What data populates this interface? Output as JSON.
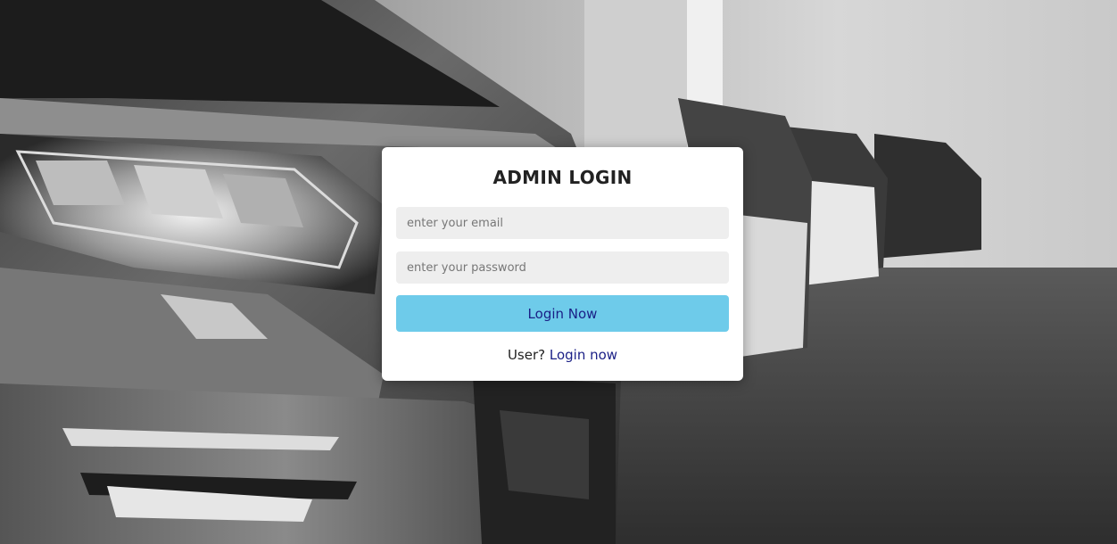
{
  "colors": {
    "card_bg": "#ffffff",
    "field_bg": "#eeeeee",
    "button_bg": "#6ecbea",
    "button_text": "#1a1f86",
    "link": "#1a1f86",
    "title": "#222222"
  },
  "background": {
    "icon": "car-photo-background"
  },
  "login_form": {
    "title": "ADMIN LOGIN",
    "email_placeholder": "enter your email",
    "email_value": "",
    "password_placeholder": "enter your password",
    "password_value": "",
    "submit_label": "Login Now",
    "switch_prompt": "User?",
    "switch_link": "Login now"
  }
}
